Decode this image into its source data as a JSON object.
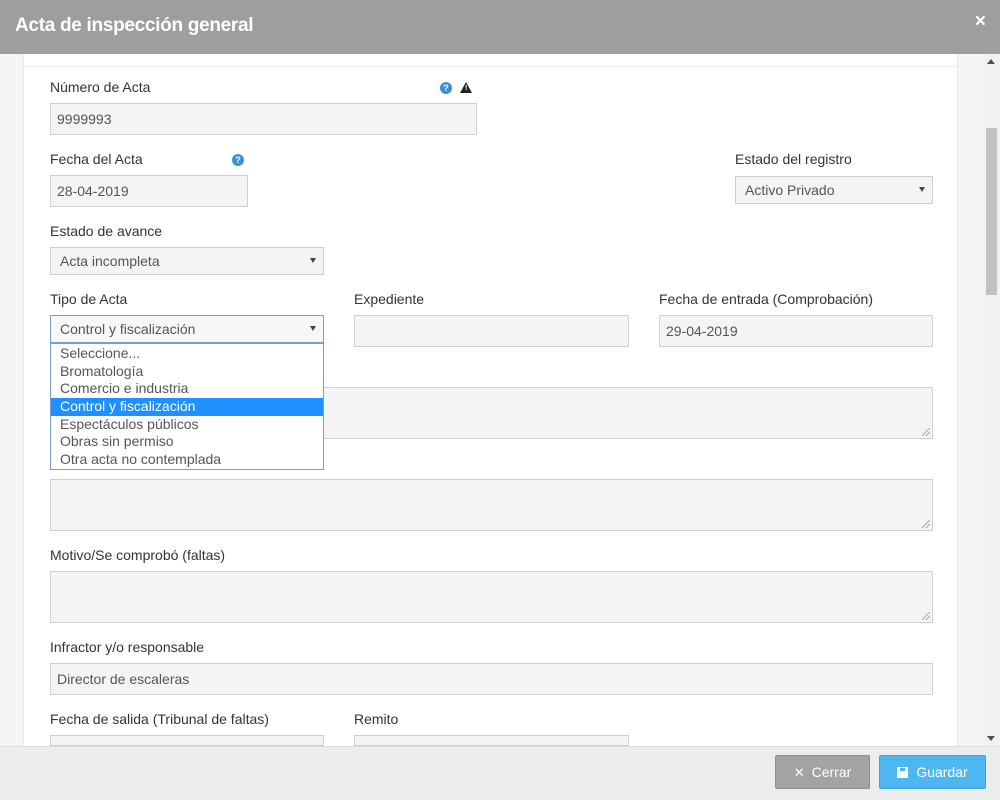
{
  "header": {
    "title": "Acta de inspección general",
    "close_symbol": "×"
  },
  "form": {
    "numero_acta": {
      "label": "Número de Acta",
      "value": "9999993"
    },
    "fecha_acta": {
      "label": "Fecha del Acta",
      "value": "28-04-2019"
    },
    "estado_registro": {
      "label": "Estado del registro",
      "value": "Activo Privado"
    },
    "estado_avance": {
      "label": "Estado de avance",
      "value": "Acta incompleta"
    },
    "tipo_acta": {
      "label": "Tipo de Acta",
      "value": "Control y fiscalización",
      "options": [
        "Seleccione...",
        "Bromatología",
        "Comercio e industria",
        "Control y fiscalización",
        "Espectáculos públicos",
        "Obras sin permiso",
        "Otra acta no contemplada"
      ],
      "selected_index": 3
    },
    "expediente": {
      "label": "Expediente",
      "value": ""
    },
    "fecha_entrada": {
      "label": "Fecha de entrada (Comprobación)",
      "value": "29-04-2019"
    },
    "motivo": {
      "label": "Motivo/Se comprobó (faltas)",
      "value": ""
    },
    "infractor": {
      "label": "Infractor y/o responsable",
      "value": "Director de escaleras"
    },
    "fecha_salida": {
      "label": "Fecha de salida (Tribunal de faltas)"
    },
    "remito": {
      "label": "Remito"
    }
  },
  "icons": {
    "help": "?",
    "warning": "!"
  },
  "footer": {
    "cerrar_label": "Cerrar",
    "guardar_label": "Guardar"
  }
}
